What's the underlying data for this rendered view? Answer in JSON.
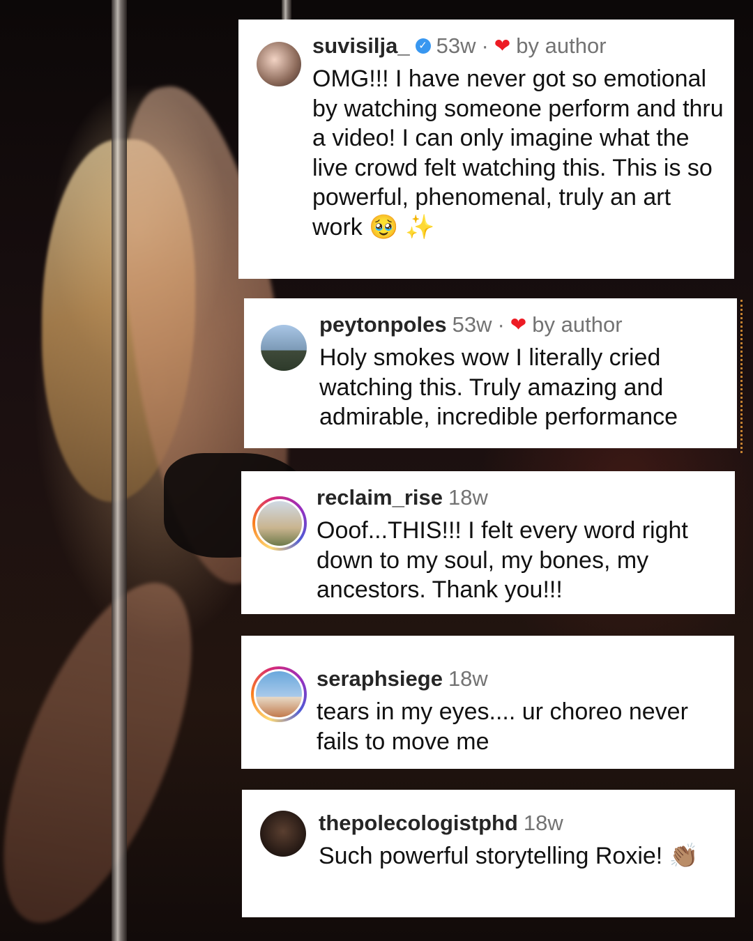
{
  "comments": [
    {
      "username": "suvisilja_",
      "verified": true,
      "time": "53w",
      "separator": "·",
      "heart": "❤",
      "by_author": "by author",
      "text": "OMG!!! I have never got so emotional by watching someone perform and thru a video! I can only imagine what the live crowd felt watching this. This is so powerful, phenomenal, truly an art work 🥹 ✨"
    },
    {
      "username": "peytonpoles",
      "time": "53w",
      "separator": "·",
      "heart": "❤",
      "by_author": "by author",
      "text": "Holy smokes wow I literally cried watching this. Truly amazing and admirable, incredible performance"
    },
    {
      "username": "reclaim_rise",
      "time": "18w",
      "text": "Ooof...THIS!!! I felt every word right down to my soul, my bones, my ancestors. Thank you!!!"
    },
    {
      "username": "seraphsiege",
      "time": "18w",
      "text": "tears in my eyes.... ur choreo never fails to move me"
    },
    {
      "username": "thepolecologistphd",
      "time": "18w",
      "text": "Such powerful storytelling Roxie! 👏🏽"
    }
  ],
  "verified_badge": "✓",
  "colors": {
    "heart": "#ed1b24",
    "verified": "#3897f0",
    "meta_gray": "#737373"
  }
}
